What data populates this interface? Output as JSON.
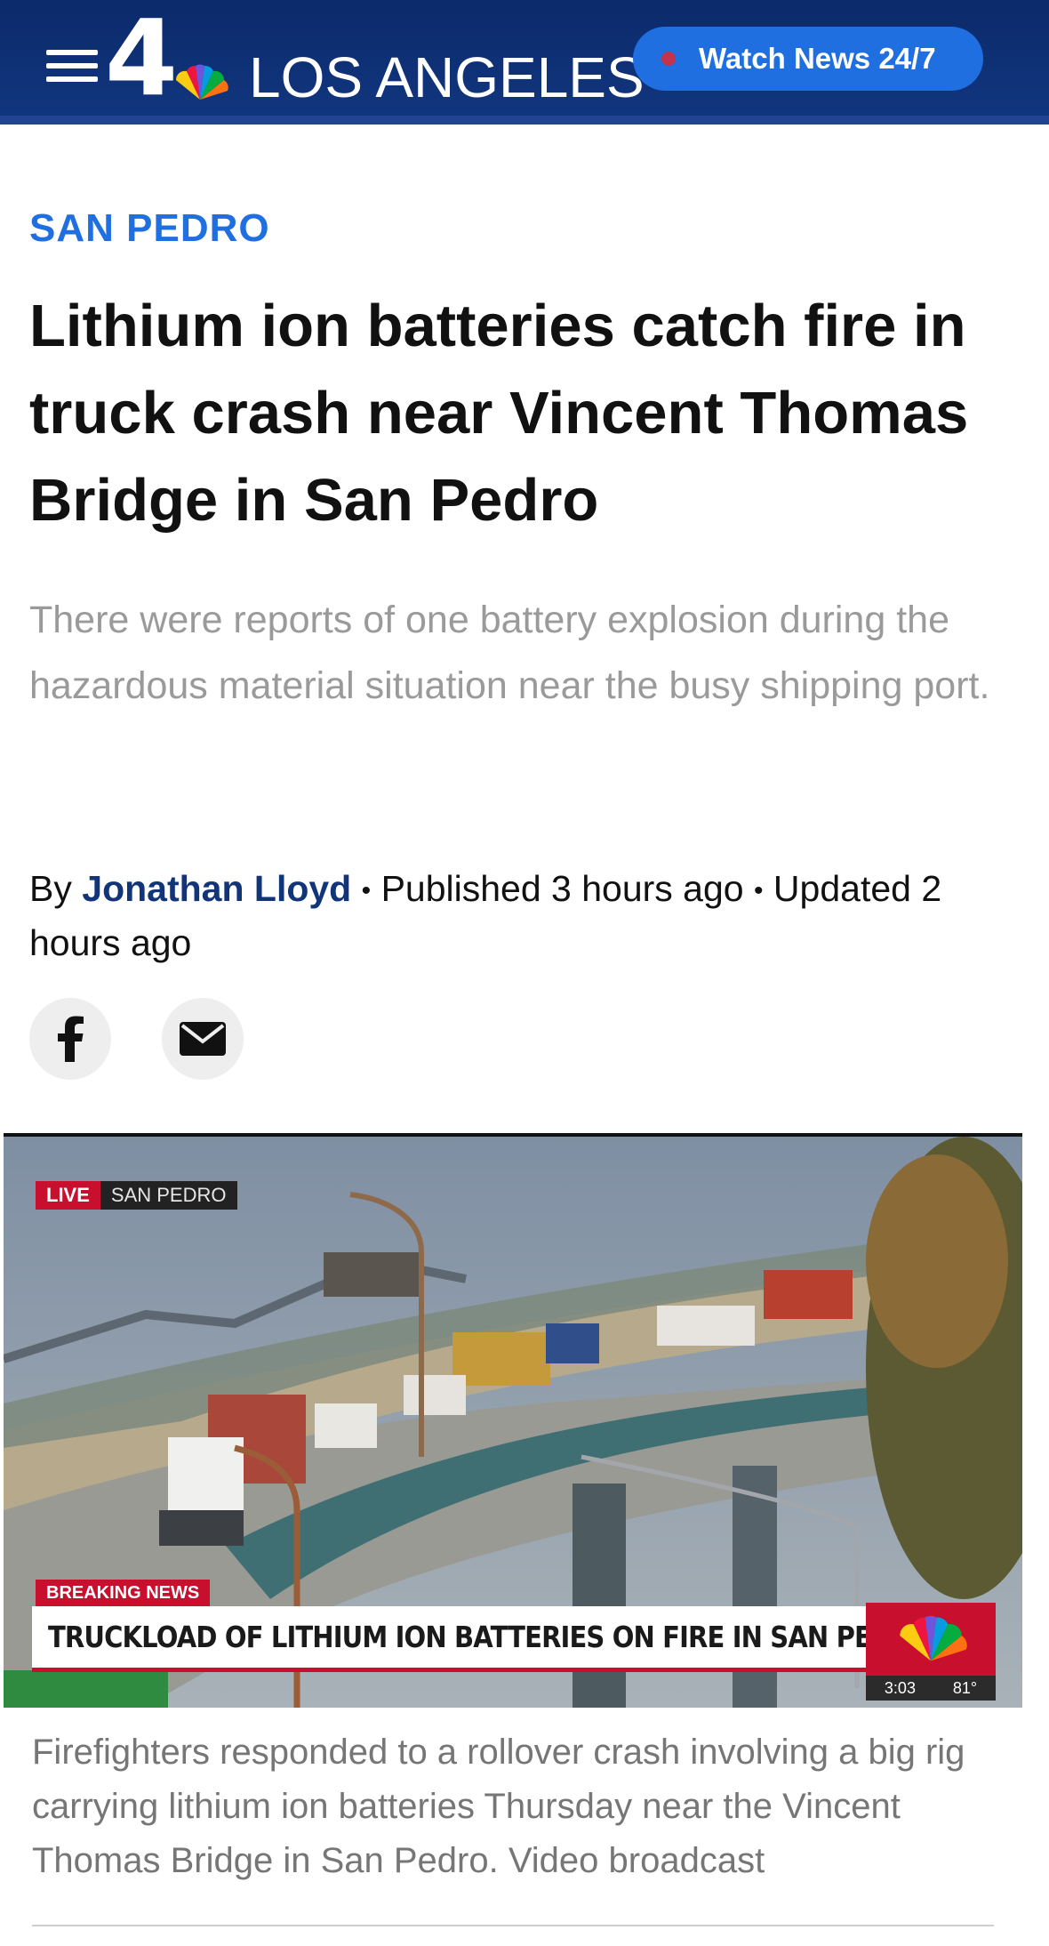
{
  "header": {
    "logo_number": "4",
    "logo_text": "LOS ANGELES",
    "watch_button_label": "Watch News 24/7",
    "menu_icon": "hamburger-menu-icon",
    "colors": {
      "background": "#0b2a6a",
      "watch_button": "#1f6fe0",
      "live_dot": "#c2334d"
    }
  },
  "article": {
    "kicker": "SAN PEDRO",
    "headline": "Lithium ion batteries catch fire in truck crash near Vincent Thomas Bridge in San Pedro",
    "dek": "There were reports of one battery explosion during the hazardous material situation near the busy shipping port.",
    "byline": {
      "prefix": "By",
      "author": "Jonathan Lloyd",
      "separator": "•",
      "published": "Published 3 hours ago",
      "updated": "Updated 2 hours ago"
    },
    "share": {
      "facebook_icon": "facebook-icon",
      "email_icon": "email-icon"
    },
    "colors": {
      "kicker": "#1f6fe0",
      "author": "#12357a",
      "dek": "#9a9a9a"
    }
  },
  "video": {
    "live_label": "LIVE",
    "live_location": "SAN PEDRO",
    "breaking_label": "BREAKING NEWS",
    "ticker_text": "TRUCKLOAD OF LITHIUM ION BATTERIES ON FIRE IN SAN PEDRO",
    "time": "3:03",
    "temperature": "81°",
    "network_icon": "nbc-peacock-icon"
  },
  "caption": {
    "text": "Firefighters responded to a rollover crash involving a big rig carrying lithium ion batteries Thursday near the Vincent Thomas Bridge in San Pedro. Video broadcast"
  }
}
